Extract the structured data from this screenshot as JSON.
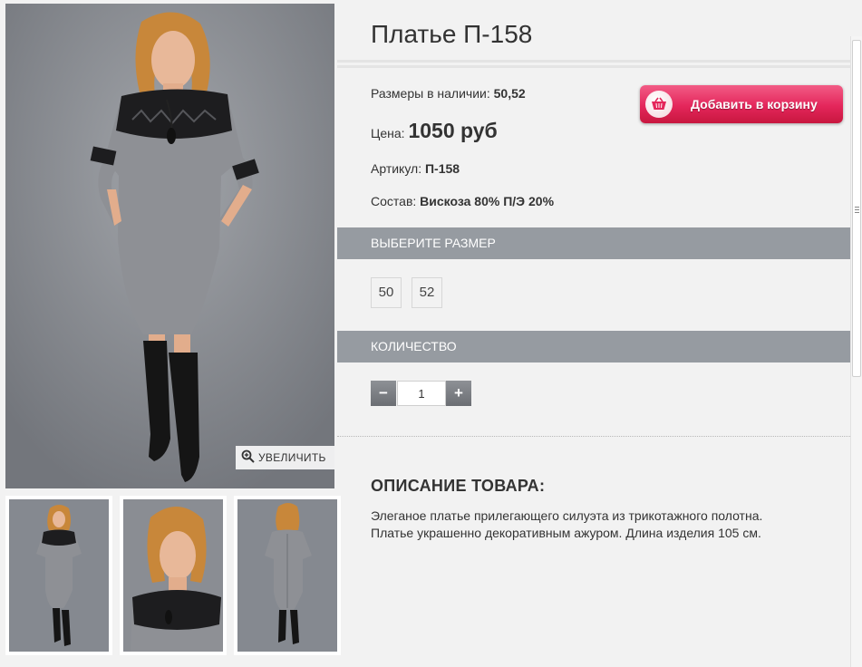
{
  "product": {
    "title": "Платье П-158",
    "sizes_label": "Размеры в наличии:",
    "sizes_value": "50,52",
    "price_label": "Цена:",
    "price_value": "1050 руб",
    "article_label": "Артикул:",
    "article_value": "П-158",
    "composition_label": "Состав:",
    "composition_value": "Вискоза 80% П/Э 20%"
  },
  "cart_button": {
    "label": "Добавить в корзину",
    "icon": "shopping-basket-icon",
    "color": "#e4265b"
  },
  "gallery": {
    "zoom_label": "УВЕЛИЧИТЬ",
    "zoom_icon": "magnifier-plus-icon"
  },
  "size_section": {
    "header": "ВЫБЕРИТЕ РАЗМЕР",
    "options": [
      "50",
      "52"
    ]
  },
  "quantity_section": {
    "header": "КОЛИЧЕСТВО",
    "minus": "−",
    "plus": "+",
    "value": "1"
  },
  "description": {
    "title": "ОПИСАНИЕ ТОВАРА:",
    "text": "Элеганое платье прилегающего силуэта из трикотажного полотна. Платье украшенно декоративным ажуром. Длина изделия 105 см."
  },
  "colors": {
    "section_bar": "#969ba1",
    "background": "#f2f2f2",
    "dress_gray": "#8e9095",
    "lace_black": "#1d1d1f"
  }
}
